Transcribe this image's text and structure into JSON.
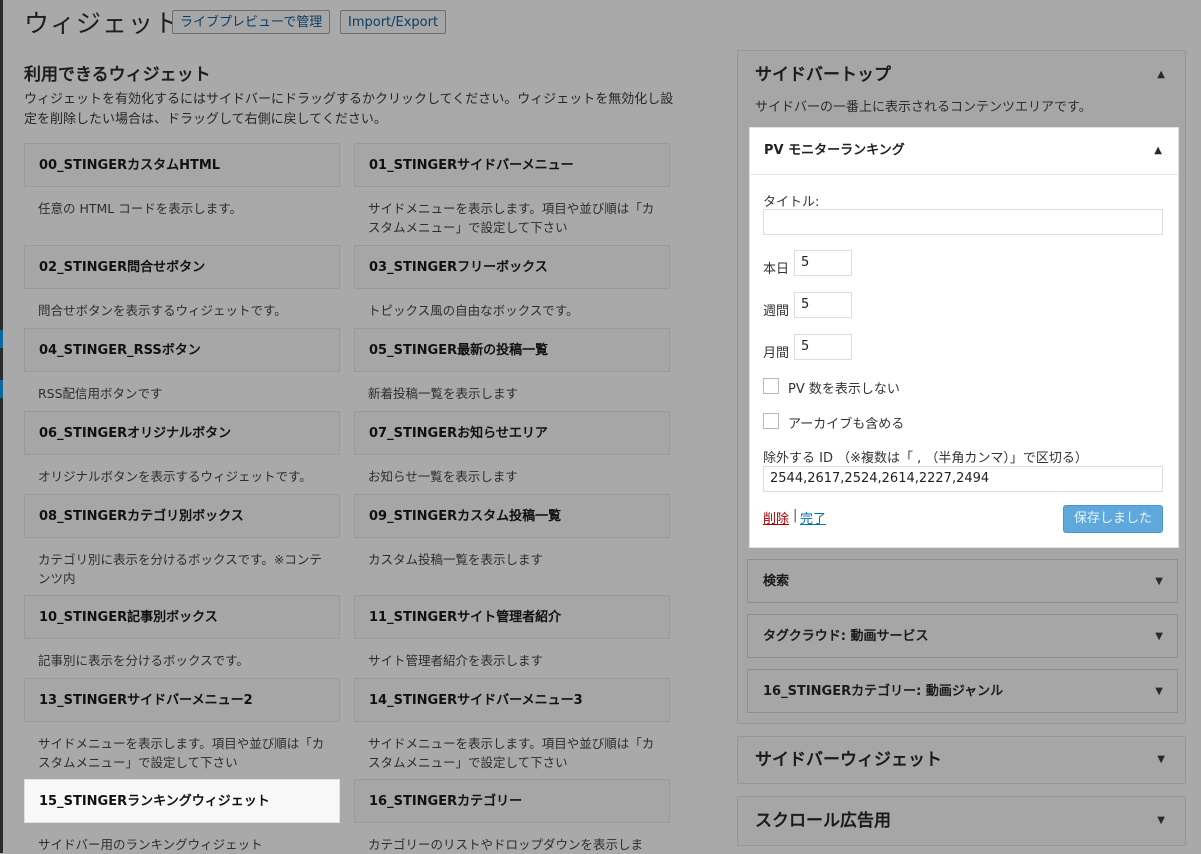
{
  "header": {
    "title": "ウィジェット",
    "live_preview_button": "ライブプレビューで管理",
    "import_export_button": "Import/Export"
  },
  "available": {
    "title": "利用できるウィジェット",
    "description": "ウィジェットを有効化するにはサイドバーにドラッグするかクリックしてください。ウィジェットを無効化し設定を削除したい場合は、ドラッグして右側に戻してください。",
    "widgets": [
      {
        "title": "00_STINGERカスタムHTML",
        "desc": "任意の HTML コードを表示します。"
      },
      {
        "title": "01_STINGERサイドバーメニュー",
        "desc": "サイドメニューを表示します。項目や並び順は「カスタムメニュー」で設定して下さい"
      },
      {
        "title": "02_STINGER問合せボタン",
        "desc": "問合せボタンを表示するウィジェットです。"
      },
      {
        "title": "03_STINGERフリーボックス",
        "desc": "トピックス風の自由なボックスです。"
      },
      {
        "title": "04_STINGER_RSSボタン",
        "desc": "RSS配信用ボタンです"
      },
      {
        "title": "05_STINGER最新の投稿一覧",
        "desc": "新着投稿一覧を表示します"
      },
      {
        "title": "06_STINGERオリジナルボタン",
        "desc": "オリジナルボタンを表示するウィジェットです。"
      },
      {
        "title": "07_STINGERお知らせエリア",
        "desc": "お知らせ一覧を表示します"
      },
      {
        "title": "08_STINGERカテゴリ別ボックス",
        "desc": "カテゴリ別に表示を分けるボックスです。※コンテンツ内"
      },
      {
        "title": "09_STINGERカスタム投稿一覧",
        "desc": "カスタム投稿一覧を表示します"
      },
      {
        "title": "10_STINGER記事別ボックス",
        "desc": "記事別に表示を分けるボックスです。"
      },
      {
        "title": "11_STINGERサイト管理者紹介",
        "desc": "サイト管理者紹介を表示します"
      },
      {
        "title": "13_STINGERサイドバーメニュー2",
        "desc": "サイドメニューを表示します。項目や並び順は「カスタムメニュー」で設定して下さい"
      },
      {
        "title": "14_STINGERサイドバーメニュー3",
        "desc": "サイドメニューを表示します。項目や並び順は「カスタムメニュー」で設定して下さい"
      },
      {
        "title": "15_STINGERランキングウィジェット",
        "desc": "サイドバー用のランキングウィジェット"
      },
      {
        "title": "16_STINGERカテゴリー",
        "desc": "カテゴリーのリストやドロップダウンを表示しま"
      }
    ]
  },
  "sidebar_top": {
    "title": "サイドバートップ",
    "description": "サイドバーの一番上に表示されるコンテンツエリアです。",
    "open_widget": {
      "title": "PV モニターランキング",
      "title_label": "タイトル:",
      "title_value": "",
      "today_label": "本日",
      "today_value": "5",
      "week_label": "週間",
      "week_value": "5",
      "month_label": "月間",
      "month_value": "5",
      "hide_pv_label": "PV 数を表示しない",
      "include_archive_label": "アーカイブも含める",
      "exclude_label": "除外する ID （※複数は「 , （半角カンマ）」で区切る）",
      "exclude_value": "2544,2617,2524,2614,2227,2494",
      "delete_link": "削除",
      "separator": "|",
      "done_link": "完了",
      "save_button": "保存しました"
    },
    "collapsed_widgets": [
      "検索",
      "タグクラウド: 動画サービス",
      "16_STINGERカテゴリー: 動画ジャンル"
    ]
  },
  "other_areas": [
    "サイドバーウィジェット",
    "スクロール広告用"
  ],
  "icons": {
    "expanded": "▲",
    "collapsed": "▼"
  }
}
